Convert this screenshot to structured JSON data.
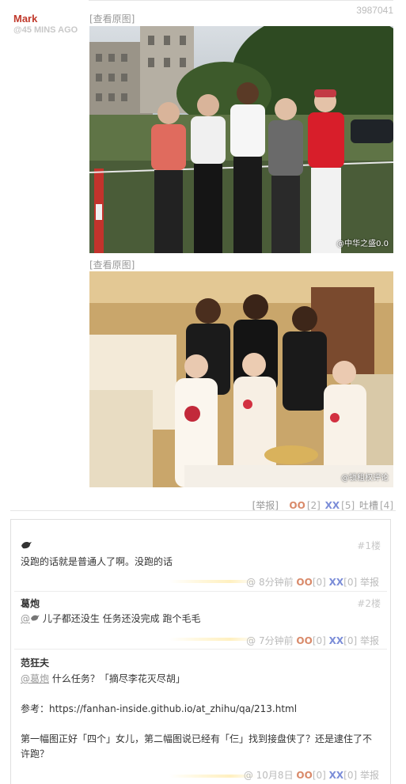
{
  "post": {
    "id": "3987041",
    "author": "Mark",
    "time": "@45 MINS AGO",
    "view_original": "[查看原图]",
    "images": [
      {
        "alt": "五人户外合影",
        "watermark": "@中华之盛0.0"
      },
      {
        "alt": "宴会厅六人合影",
        "watermark": "@锁租权评论"
      }
    ],
    "actions": {
      "report": "[举报]",
      "oo": "OO",
      "oo_count": "[2]",
      "xx": "XX",
      "xx_count": "[5]",
      "tucao": "吐槽",
      "tucao_count": "[4]"
    }
  },
  "comments": [
    {
      "author": "",
      "author_icon": "bird-icon",
      "floor": "#1楼",
      "text": "没跑的话就是普通人了啊。没跑的话",
      "time": "@ 8分钟前",
      "oo": "OO",
      "oo_count": "[0]",
      "xx": "XX",
      "xx_count": "[0]",
      "report": "举报"
    },
    {
      "author": "葛炮",
      "floor": "#2楼",
      "mention": "@",
      "text": "儿子都还没生 任务还没完成 跑个毛毛",
      "time": "@ 7分钟前",
      "oo": "OO",
      "oo_count": "[0]",
      "xx": "XX",
      "xx_count": "[0]",
      "report": "举报"
    },
    {
      "author": "范狂夫",
      "floor": "",
      "mention": "@葛炮",
      "text_line1": "什么任务？「摘尽李花灭尽胡」",
      "text_line2": "参考：https://fanhan-inside.github.io/at_zhihu/qa/213.html",
      "text_line3": "第一幅图正好「四个」女儿，第二幅图说已经有「仨」找到接盘侠了？还是逮住了不许跑？",
      "time": "@ 10月8日",
      "oo": "OO",
      "oo_count": "[0]",
      "xx": "XX",
      "xx_count": "[0]",
      "report": "举报"
    }
  ]
}
